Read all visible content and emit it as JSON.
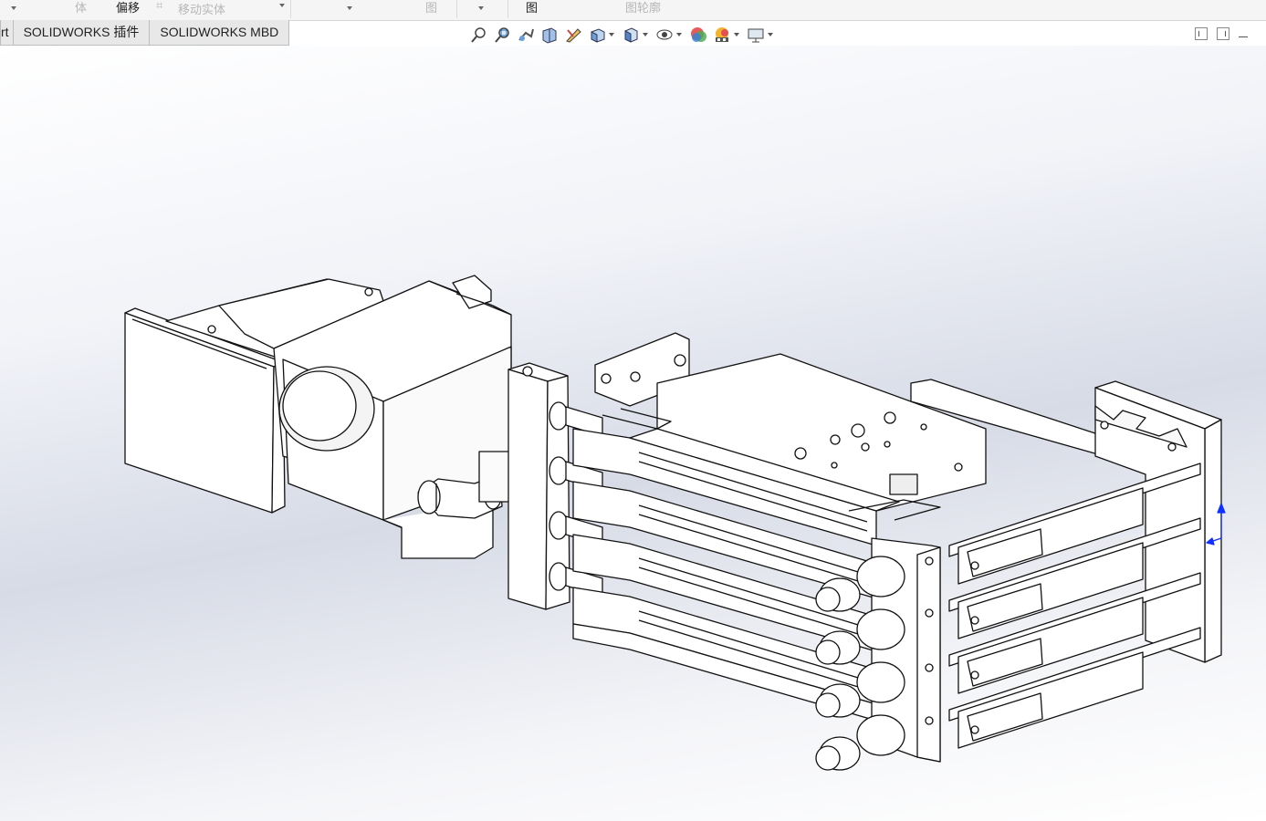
{
  "ribbon": {
    "items": [
      "体",
      "偏移",
      "移动实体",
      "图",
      "图",
      "图轮廓"
    ]
  },
  "tabs": [
    "rt",
    "SOLIDWORKS 插件",
    "SOLIDWORKS MBD"
  ],
  "heads_up_toolbar": {
    "icons": [
      "zoom-to-fit-icon",
      "zoom-to-area-icon",
      "previous-view-icon",
      "section-view-icon",
      "dynamic-annotation-icon",
      "view-orientation-icon",
      "display-style-icon",
      "hide-show-items-icon",
      "edit-appearance-icon",
      "apply-scene-icon",
      "view-settings-icon"
    ]
  },
  "colors": {
    "triad_y": "#1030ff",
    "ribbon_bg": "#f5f5f5",
    "tab_bg": "#e8e8e8"
  }
}
